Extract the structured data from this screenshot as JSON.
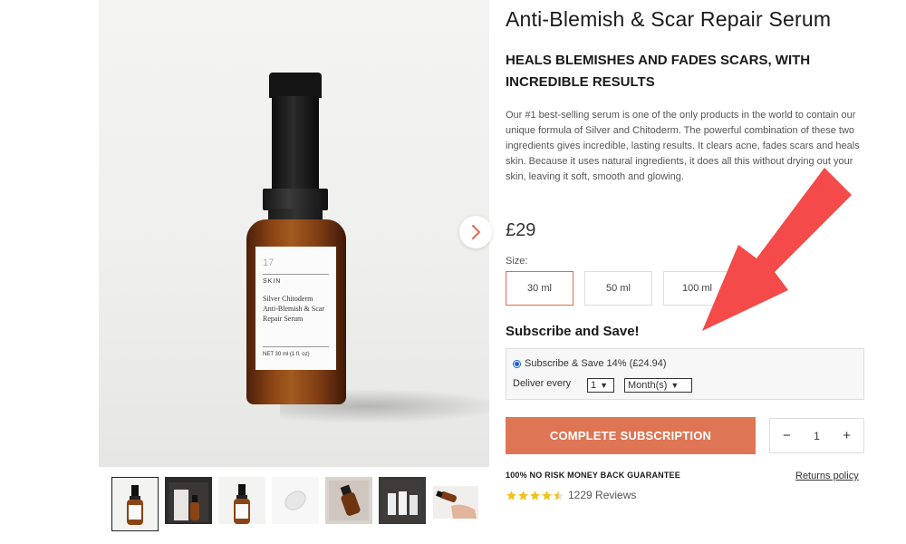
{
  "product": {
    "title": "Anti-Blemish & Scar Repair Serum",
    "tagline": "HEALS BLEMISHES AND FADES SCARS, WITH INCREDIBLE RESULTS",
    "description": "Our #1 best-selling serum is one of the only products in the world to contain our unique formula of Silver and Chitoderm. The powerful combination of these two ingredients gives incredible, lasting results. It clears acne, fades scars and heals skin. Because it uses natural ingredients, it does all this without drying out your skin, leaving it soft, smooth and glowing.",
    "price": "£29"
  },
  "bottle_label": {
    "logo": "17",
    "brand": "SKIN",
    "name": "Silver Chitoderm Anti-Blemish & Scar Repair Serum",
    "net": "NET 30 ml (1 fl. oz)"
  },
  "size": {
    "label": "Size:",
    "options": [
      "30 ml",
      "50 ml",
      "100 ml"
    ],
    "selected": "30 ml"
  },
  "subscription": {
    "heading": "Subscribe and Save!",
    "option_label": "Subscribe & Save 14% (£24.94)",
    "deliver_label": "Deliver every",
    "interval_value": "1",
    "interval_unit": "Month(s)"
  },
  "cta": {
    "label": "COMPLETE SUBSCRIPTION"
  },
  "quantity": {
    "minus": "−",
    "value": "1",
    "plus": "+"
  },
  "guarantee": "100% NO RISK MONEY BACK GUARANTEE",
  "returns_link": "Returns policy",
  "reviews": {
    "rating": 4.5,
    "count_label": "1229 Reviews"
  },
  "colors": {
    "accent": "#de7656",
    "star": "#f2c21a",
    "arrow": "#f44a4a"
  },
  "icons": {
    "next": "chevron-right-icon",
    "star": "star-icon"
  }
}
